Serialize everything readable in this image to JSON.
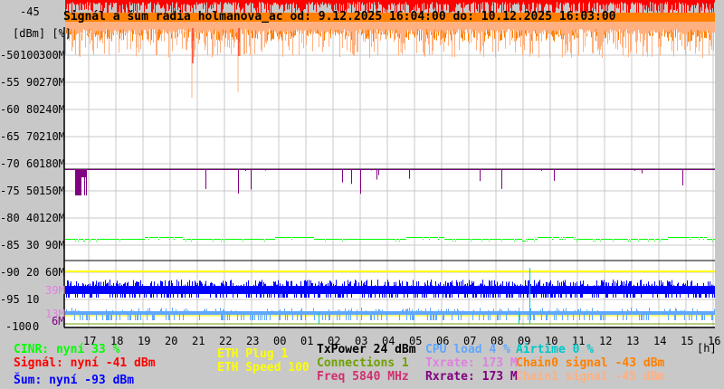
{
  "chart_data": {
    "type": "line",
    "title": "Signál a šum radia holmanova_ac od: 9.12.2025 16:04:00 do: 10.12.2025 16:03:00",
    "ylabel": "[dBm] [%]",
    "xlabel": "[h]",
    "ylim": [
      -100,
      -45
    ],
    "y_ticks_dbm": [
      "-45",
      "-50",
      "-55",
      "-60",
      "-65",
      "-70",
      "-75",
      "-80",
      "-85",
      "-90",
      "-95",
      "-100"
    ],
    "y_ticks_pct": [
      "100",
      "90",
      "80",
      "70",
      "60",
      "50",
      "40",
      "30",
      "20",
      "10",
      "0"
    ],
    "y_ticks_rate": [
      "300M",
      "270M",
      "240M",
      "210M",
      "180M",
      "150M",
      "120M",
      "90M",
      "60M"
    ],
    "rate_markers": [
      {
        "label": "39M",
        "color": "#e080e0"
      },
      {
        "label": "13M",
        "color": "#e080e0"
      },
      {
        "label": "6M",
        "color": "#800080"
      }
    ],
    "x_ticks": [
      "17",
      "18",
      "19",
      "20",
      "21",
      "22",
      "23",
      "00",
      "01",
      "02",
      "03",
      "04",
      "05",
      "06",
      "07",
      "08",
      "09",
      "10",
      "11",
      "12",
      "13",
      "14",
      "15",
      "16"
    ],
    "grid": true,
    "series": [
      {
        "name": "Signál",
        "unit": "dBm",
        "approx_level": -41,
        "color": "#ff0000"
      },
      {
        "name": "Chain0 signal",
        "unit": "dBm",
        "approx_level": -43,
        "color": "#ff8000"
      },
      {
        "name": "Chain1 signal",
        "unit": "dBm",
        "approx_level": -45,
        "color": "#ffb080"
      },
      {
        "name": "Rxrate",
        "unit": "Mbps",
        "approx_level": 173,
        "color": "#800080"
      },
      {
        "name": "CINR",
        "unit": "%",
        "approx_level": 33,
        "color": "#00ff00"
      },
      {
        "name": "ETH Speed",
        "unit": "Mbps",
        "approx_level": 100,
        "color": "#ffff00"
      },
      {
        "name": "Šum",
        "unit": "dBm",
        "approx_level": -93,
        "color": "#0000ff"
      },
      {
        "name": "CPU load",
        "unit": "%",
        "approx_level": 4,
        "color": "#60a8ff"
      },
      {
        "name": "Airtime",
        "unit": "%",
        "approx_level": 0,
        "color": "#00c8c8"
      }
    ]
  },
  "legend": {
    "cinr": "CINR: nyní 33 %",
    "signal": "Signál: nyní -41 dBm",
    "noise": "Šum: nyní -93 dBm",
    "eth_plug": "ETH Plug 1",
    "eth_speed": "ETH Speed 100",
    "txpower": "TxPower 24 dBm",
    "connections": "Connections 1",
    "freq": "Freq 5840 MHz",
    "cpu": "CPU load 4 %",
    "txrate": "Txrate: 173 M",
    "rxrate": "Rxrate: 173 M",
    "airtime": "Airtime 0 %",
    "chain0": "Chain0 signal -43 dBm",
    "chain1": "Chain1 signal -45 dBm"
  },
  "colors": {
    "signal": "#ff0000",
    "chain0": "#ff8000",
    "chain1": "#ffb080",
    "rx": "#800080",
    "cinr": "#00ff00",
    "eth": "#ffff00",
    "noise": "#0000ff",
    "cpu": "#60a8ff",
    "air": "#00c8c8",
    "tx": "#e080e0",
    "freq": "#d03070",
    "conn": "#70a000"
  }
}
